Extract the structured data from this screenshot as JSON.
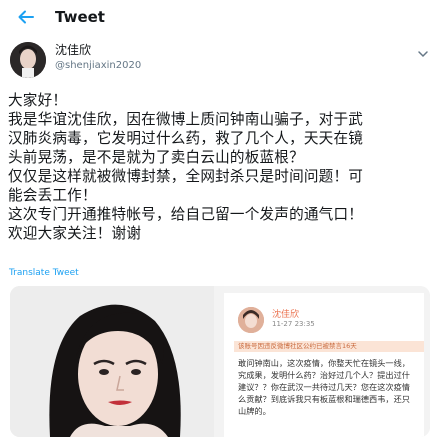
{
  "header": {
    "title": "Tweet",
    "back_icon": "arrow-left-icon",
    "accent_color": "#1da1f2"
  },
  "user": {
    "display_name": "沈佳欣",
    "handle": "@shenjiaxin2020"
  },
  "tweet": {
    "lines": [
      "大家好！",
      "我是华谊沈佳欣，因在微博上质问钟南山骗子，对于武",
      "汉肺炎病毒，它发明过什么药，救了几个人，天天在镜",
      "头前晃荡，是不是就为了卖白云山的板蓝根？",
      "仅仅是这样就被微博封禁，全网封杀只是时间问题！可",
      "能会丢工作！",
      "这次专门开通推特帐号，给自己留一个发声的通气口！",
      "欢迎大家关注！谢谢"
    ],
    "translate_label": "Translate Tweet"
  },
  "screenshot": {
    "name": "沈佳欣",
    "date": "11-27 23:35",
    "banner": "该账号因违反微博社区公约已被禁言16天",
    "body_lines": [
      "敢问钟南山，这次疫情，你整天忙在镜头一线，",
      "究成果，发明什么药？治好过几个人？提出过什",
      "建议？？你在武汉一共待过几天？您在这次疫情",
      "么贡献？到底诉我只有板蓝根和瑞德西韦，还只",
      "山牌的。"
    ]
  }
}
